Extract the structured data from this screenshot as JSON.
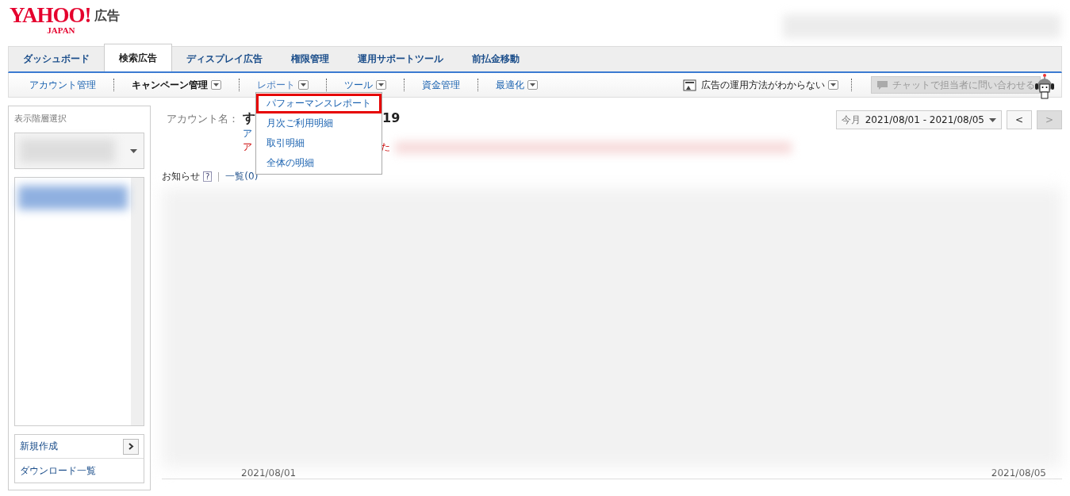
{
  "logo": {
    "brand": "YAHOO!",
    "sub": "JAPAN",
    "product": "広告"
  },
  "tabs": [
    {
      "label": "ダッシュボード",
      "selected": false
    },
    {
      "label": "検索広告",
      "selected": true
    },
    {
      "label": "ディスプレイ広告",
      "selected": false
    },
    {
      "label": "権限管理",
      "selected": false
    },
    {
      "label": "運用サポートツール",
      "selected": false
    },
    {
      "label": "前払金移動",
      "selected": false
    }
  ],
  "subnav": [
    {
      "label": "アカウント管理",
      "dropdown": false,
      "selected": false,
      "expanded": false
    },
    {
      "label": "キャンペーン管理",
      "dropdown": true,
      "selected": true,
      "expanded": false
    },
    {
      "label": "レポート",
      "dropdown": true,
      "selected": false,
      "expanded": true
    },
    {
      "label": "ツール",
      "dropdown": true,
      "selected": false,
      "expanded": false
    },
    {
      "label": "資金管理",
      "dropdown": false,
      "selected": false,
      "expanded": false
    },
    {
      "label": "最適化",
      "dropdown": true,
      "selected": false,
      "expanded": false
    }
  ],
  "report_menu": [
    {
      "label": "パフォーマンスレポート",
      "highlighted": true
    },
    {
      "label": "月次ご利用明細",
      "highlighted": false
    },
    {
      "label": "取引明細",
      "highlighted": false
    },
    {
      "label": "全体の明細",
      "highlighted": false
    }
  ],
  "help": {
    "label": "広告の運用方法がわからない"
  },
  "chat_button": {
    "label": "チャットで担当者に問い合わせる",
    "disabled": true
  },
  "sidebar": {
    "title": "表示階層選択",
    "actions": [
      {
        "label": "新規作成",
        "arrow": true
      },
      {
        "label": "ダウンロード一覧",
        "arrow": false
      }
    ]
  },
  "account": {
    "label": "アカウント名：",
    "name_start": "す",
    "name_end": "19",
    "link_fragment": "ア",
    "alert_start": "ア",
    "alert_end": "た"
  },
  "date_range": {
    "preset": "今月",
    "range": "2021/08/01 - 2021/08/05",
    "prev": {
      "label": "<",
      "disabled": false
    },
    "next": {
      "label": ">",
      "disabled": true
    }
  },
  "notices": {
    "label": "お知らせ",
    "help": "?",
    "list": "一覧(0)"
  },
  "axis_dates": [
    "2021/08/01",
    "2021/08/05"
  ]
}
